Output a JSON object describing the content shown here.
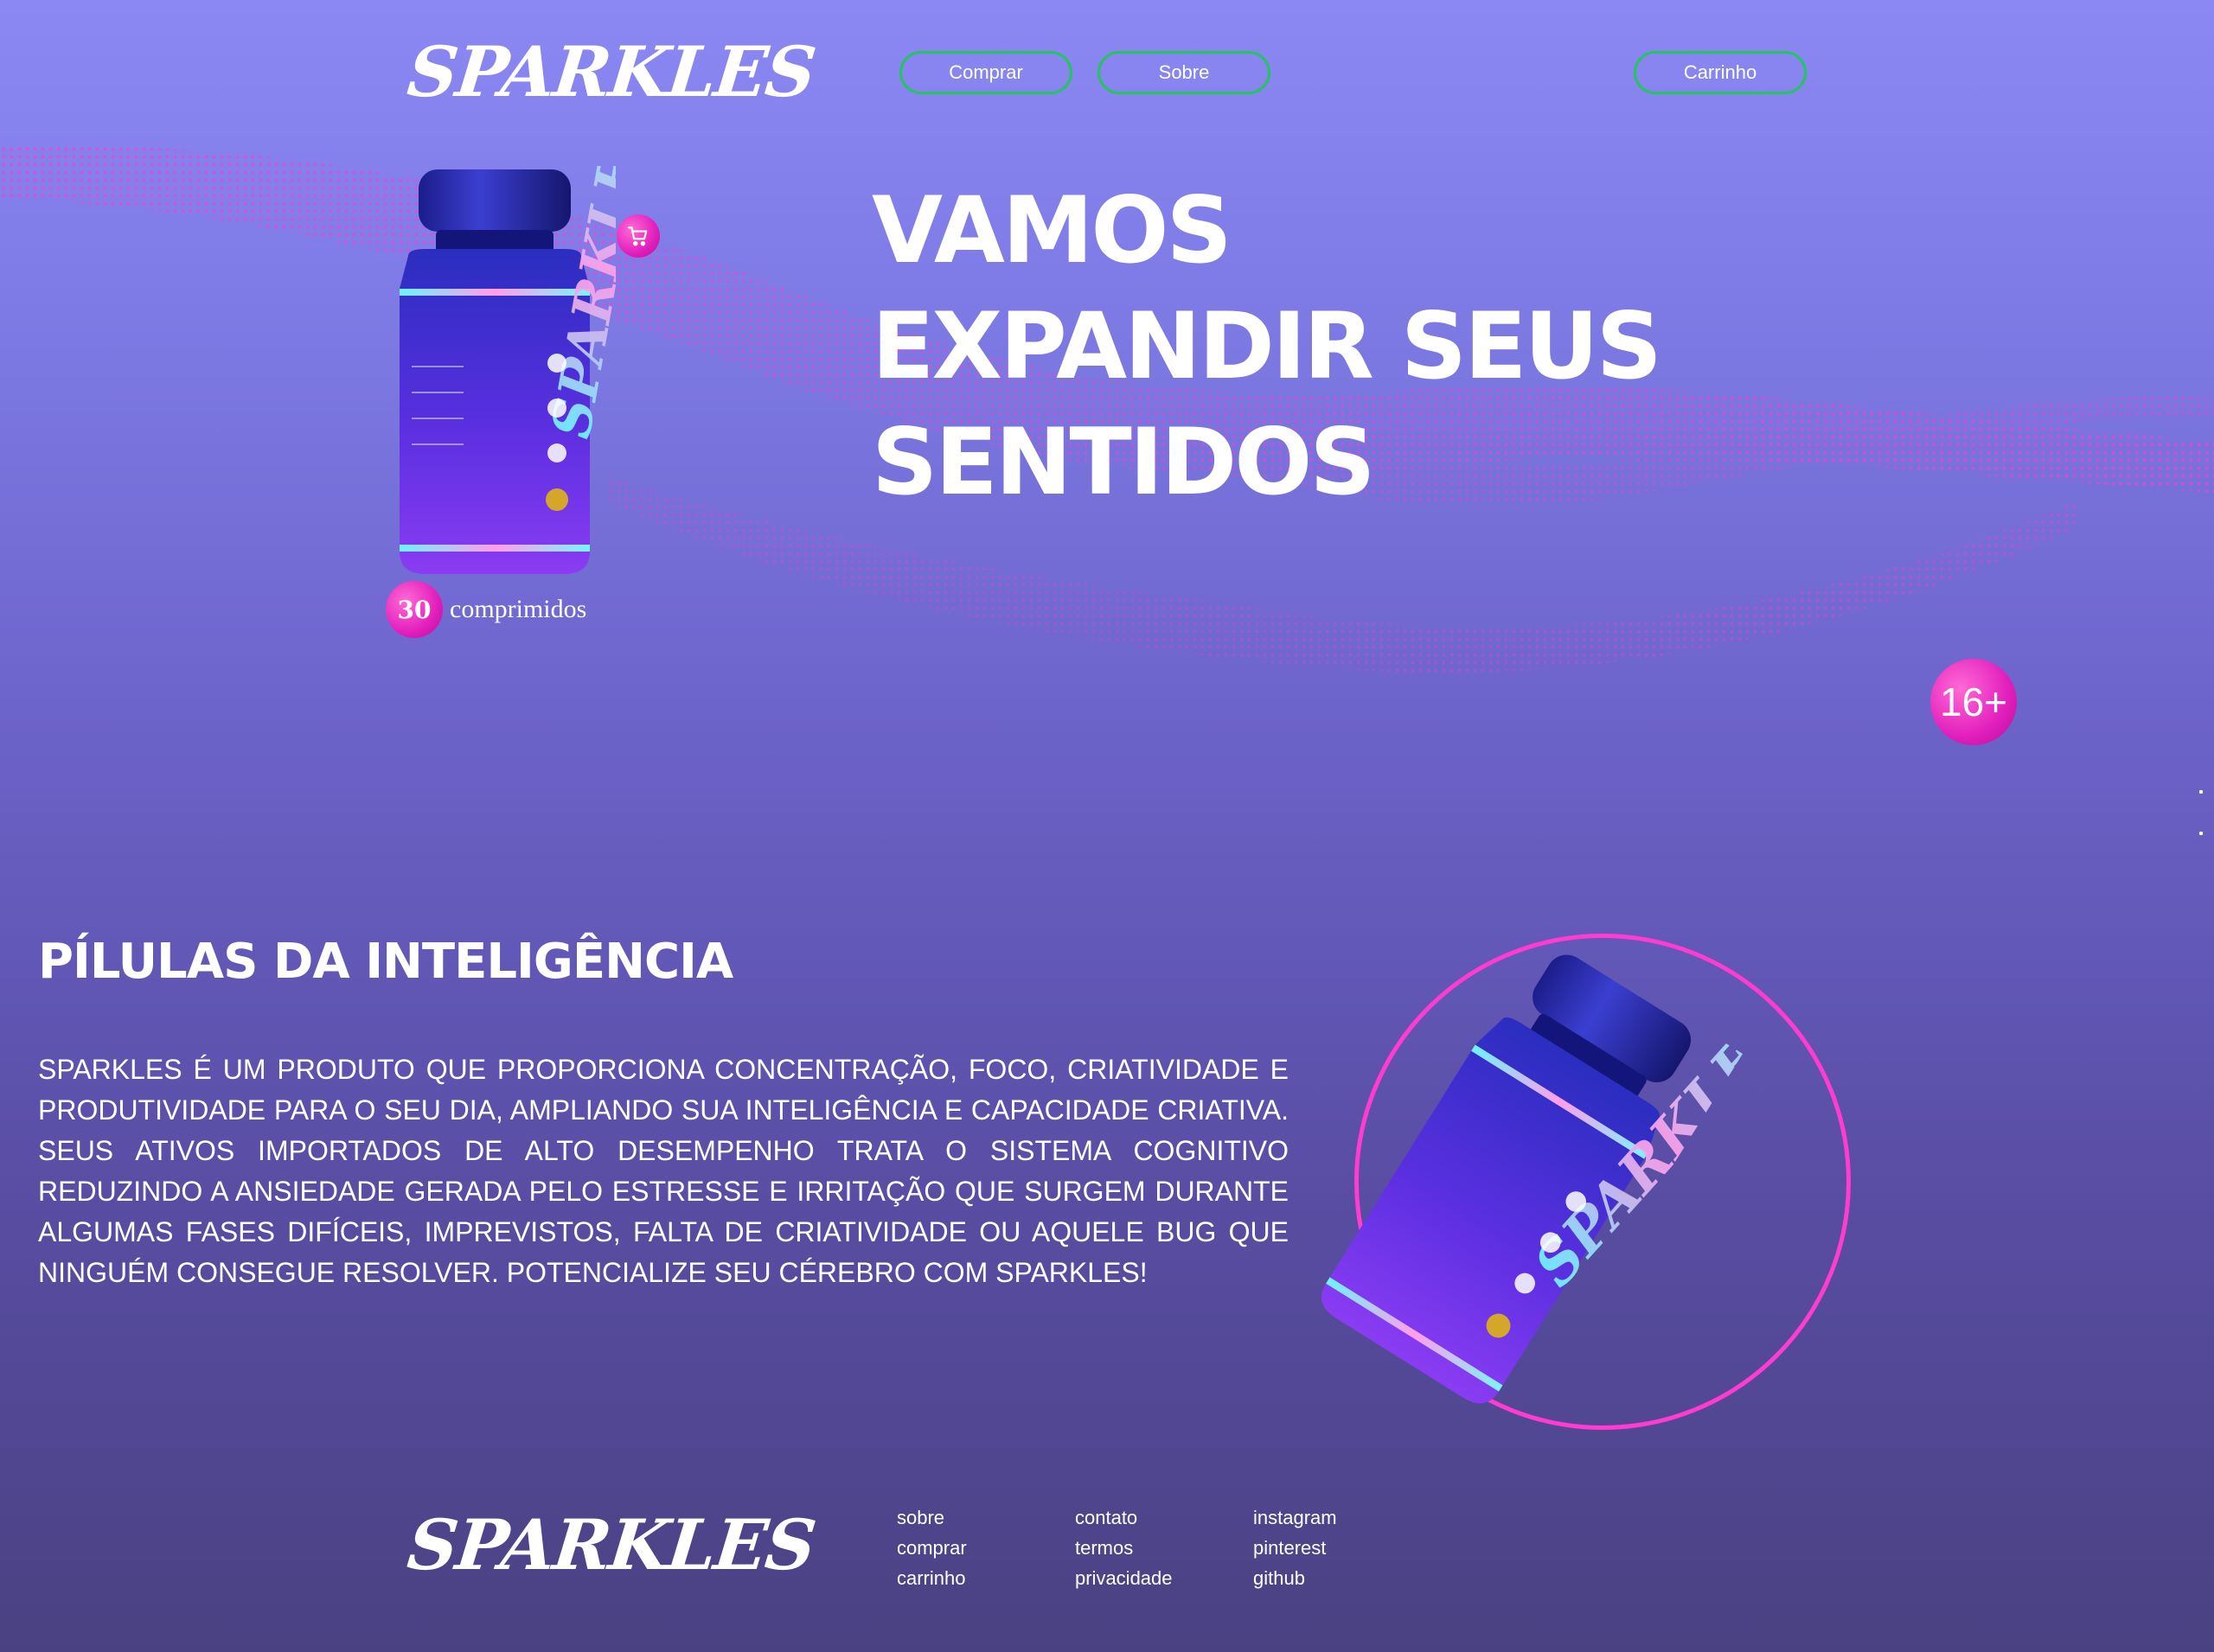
{
  "header": {
    "logo": "SPARKLES",
    "nav": {
      "comprar": "Comprar",
      "sobre": "Sobre",
      "carrinho": "Carrinho"
    }
  },
  "hero": {
    "title_lines": [
      "VAMOS",
      "EXPANDIR SEUS",
      "SENTIDOS"
    ],
    "product": {
      "brand": "SPARKLES",
      "count": "30",
      "count_label": "comprimidos",
      "cart_icon": "shopping-cart-icon"
    },
    "age_badge": "16+"
  },
  "section": {
    "title": "PÍLULAS DA INTELIGÊNCIA",
    "text": "SPARKLES É UM PRODUTO QUE PROPORCIONA CONCENTRAÇÃO, FOCO, CRIATIVIDADE E PRODUTIVIDADE PARA O SEU DIA, AMPLIANDO SUA INTELIGÊNCIA E CAPACIDADE CRIATIVA. SEUS ATIVOS IMPORTADOS DE ALTO DESEMPENHO TRATA O SISTEMA COGNITIVO REDUZINDO A ANSIEDADE GERADA PELO ESTRESSE E IRRITAÇÃO QUE SURGEM DURANTE ALGUMAS FASES DIFÍCEIS, IMPREVISTOS, FALTA DE CRIATIVIDADE OU AQUELE BUG QUE NINGUÉM CONSEGUE RESOLVER. POTENCIALIZE SEU CÉREBRO COM SPARKLES!"
  },
  "footer": {
    "logo": "SPARKLES",
    "columns": [
      [
        "sobre",
        "comprar",
        "carrinho"
      ],
      [
        "contato",
        "termos",
        "privacidade"
      ],
      [
        "instagram",
        "pinterest",
        "github"
      ]
    ]
  },
  "colors": {
    "accent_pink": "#e21fbd",
    "ring_pink": "#ff3bd0",
    "button_border_green": "#22c55e",
    "bg_top": "#8b88f4",
    "bg_bottom": "#4a4182"
  }
}
